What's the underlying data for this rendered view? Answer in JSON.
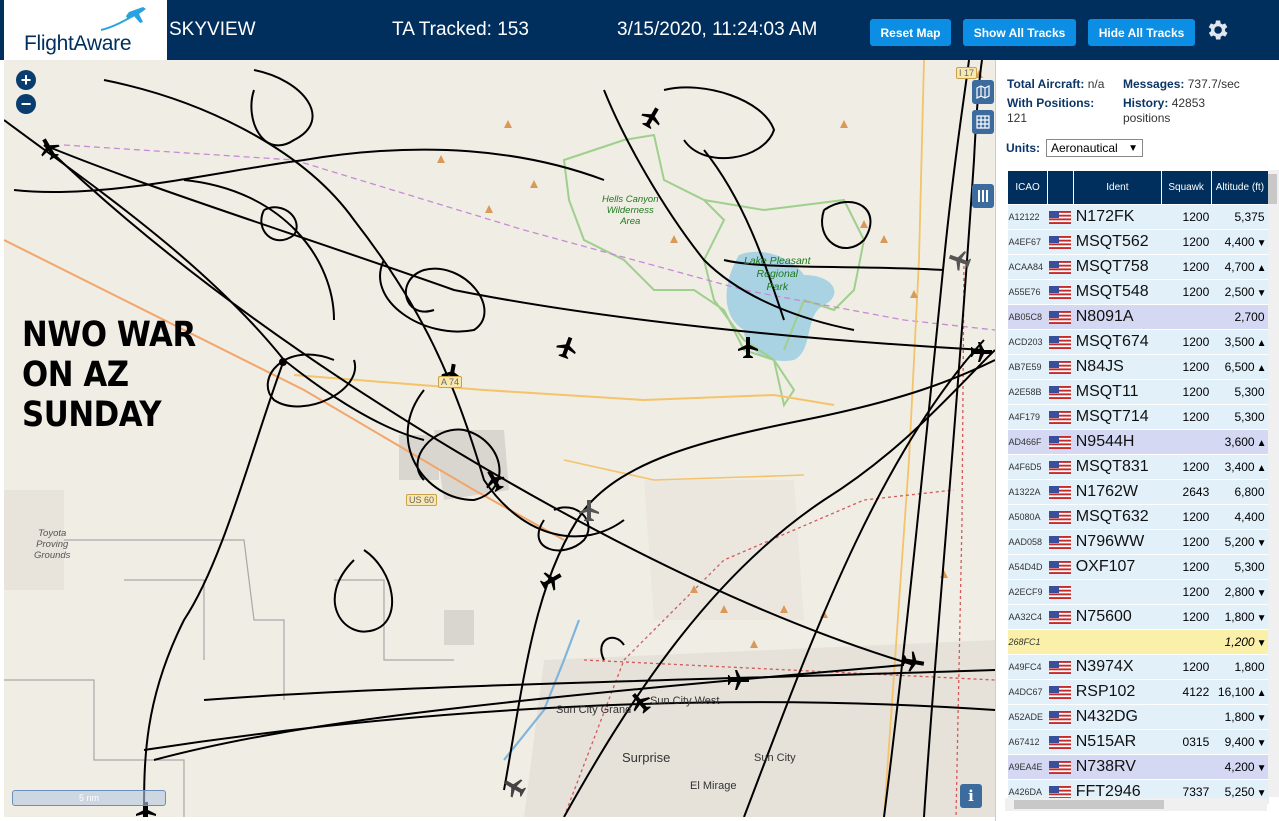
{
  "header": {
    "logo_text": "FlightAware",
    "app_name": "SKYVIEW",
    "tracked_label": "TA Tracked: 153",
    "datetime": "3/15/2020, 11:24:03 AM",
    "buttons": {
      "reset_map": "Reset Map",
      "show_all_tracks": "Show All Tracks",
      "hide_all_tracks": "Hide All Tracks"
    },
    "settings_icon": "gear-icon"
  },
  "map": {
    "overlay_lines": [
      "NWO WAR",
      "ON AZ",
      "SUNDAY"
    ],
    "scale_label": "5 nm",
    "places": {
      "hells_canyon": [
        "Hells Canyon",
        "Wilderness",
        "Area"
      ],
      "lake_pleasant": [
        "Lake Pleasant",
        "Regional",
        "Park"
      ],
      "toyota": [
        "Toyota",
        "Proving",
        "Grounds"
      ],
      "sun_city_grand": "Sun City Grand",
      "sun_city_west": "Sun City West",
      "surprise": "Surprise",
      "sun_city": "Sun City",
      "el_mirage": "El Mirage"
    },
    "shields": {
      "i17": "I 17",
      "a74": "A 74",
      "us60": "US 60"
    },
    "zoom_in": "+",
    "zoom_out": "−",
    "info": "i"
  },
  "panel": {
    "total_aircraft_label": "Total Aircraft:",
    "total_aircraft_value": "n/a",
    "messages_label": "Messages:",
    "messages_value": "737.7/sec",
    "with_positions_label": "With Positions:",
    "with_positions_value": "121",
    "history_label": "History:",
    "history_value": "42853",
    "history_unit": "positions",
    "units_label": "Units:",
    "units_value": "Aeronautical",
    "columns": [
      "ICAO",
      "",
      "Ident",
      "Squawk",
      "Altitude (ft)"
    ],
    "rows": [
      {
        "icao": "A12122",
        "ident": "N172FK",
        "squawk": "1200",
        "alt": "5,375",
        "trend": "",
        "style": "blue"
      },
      {
        "icao": "A4EF67",
        "ident": "MSQT562",
        "squawk": "1200",
        "alt": "4,400",
        "trend": "▼",
        "style": "blue"
      },
      {
        "icao": "ACAA84",
        "ident": "MSQT758",
        "squawk": "1200",
        "alt": "4,700",
        "trend": "▲",
        "style": "blue"
      },
      {
        "icao": "A55E76",
        "ident": "MSQT548",
        "squawk": "1200",
        "alt": "2,500",
        "trend": "▼",
        "style": "blue"
      },
      {
        "icao": "AB05C8",
        "ident": "N8091A",
        "squawk": "",
        "alt": "2,700",
        "trend": "",
        "style": "purple"
      },
      {
        "icao": "ACD203",
        "ident": "MSQT674",
        "squawk": "1200",
        "alt": "3,500",
        "trend": "▲",
        "style": "blue"
      },
      {
        "icao": "AB7E59",
        "ident": "N84JS",
        "squawk": "1200",
        "alt": "6,500",
        "trend": "▲",
        "style": "blue"
      },
      {
        "icao": "A2E58B",
        "ident": "MSQT11",
        "squawk": "1200",
        "alt": "5,300",
        "trend": "",
        "style": "blue"
      },
      {
        "icao": "A4F179",
        "ident": "MSQT714",
        "squawk": "1200",
        "alt": "5,300",
        "trend": "",
        "style": "blue"
      },
      {
        "icao": "AD466F",
        "ident": "N9544H",
        "squawk": "",
        "alt": "3,600",
        "trend": "▲",
        "style": "purple"
      },
      {
        "icao": "A4F6D5",
        "ident": "MSQT831",
        "squawk": "1200",
        "alt": "3,400",
        "trend": "▲",
        "style": "blue"
      },
      {
        "icao": "A1322A",
        "ident": "N1762W",
        "squawk": "2643",
        "alt": "6,800",
        "trend": "",
        "style": "blue"
      },
      {
        "icao": "A5080A",
        "ident": "MSQT632",
        "squawk": "1200",
        "alt": "4,400",
        "trend": "",
        "style": "blue"
      },
      {
        "icao": "AAD058",
        "ident": "N796WW",
        "squawk": "1200",
        "alt": "5,200",
        "trend": "▼",
        "style": "blue"
      },
      {
        "icao": "A54D4D",
        "ident": "OXF107",
        "squawk": "1200",
        "alt": "5,300",
        "trend": "",
        "style": "blue"
      },
      {
        "icao": "A2ECF9",
        "ident": "",
        "squawk": "1200",
        "alt": "2,800",
        "trend": "▼",
        "style": "blue"
      },
      {
        "icao": "AA32C4",
        "ident": "N75600",
        "squawk": "1200",
        "alt": "1,800",
        "trend": "▼",
        "style": "blue"
      },
      {
        "icao": "268FC1",
        "ident": "",
        "squawk": "",
        "alt": "1,200",
        "trend": "▼",
        "style": "yellow"
      },
      {
        "icao": "A49FC4",
        "ident": "N3974X",
        "squawk": "1200",
        "alt": "1,800",
        "trend": "",
        "style": "blue"
      },
      {
        "icao": "A4DC67",
        "ident": "RSP102",
        "squawk": "4122",
        "alt": "16,100",
        "trend": "▲",
        "style": "blue"
      },
      {
        "icao": "A52ADE",
        "ident": "N432DG",
        "squawk": "",
        "alt": "1,800",
        "trend": "▼",
        "style": "blue"
      },
      {
        "icao": "A67412",
        "ident": "N515AR",
        "squawk": "0315",
        "alt": "9,400",
        "trend": "▼",
        "style": "blue"
      },
      {
        "icao": "A9EA4E",
        "ident": "N738RV",
        "squawk": "",
        "alt": "4,200",
        "trend": "▼",
        "style": "purple"
      },
      {
        "icao": "A426DA",
        "ident": "FFT2946",
        "squawk": "7337",
        "alt": "5,250",
        "trend": "▼",
        "style": "blue"
      }
    ]
  }
}
